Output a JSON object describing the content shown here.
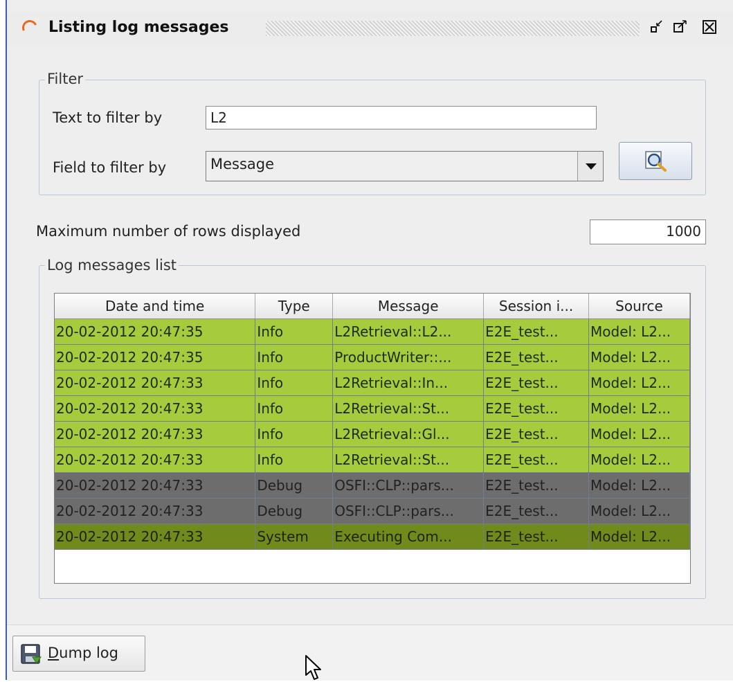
{
  "window": {
    "title": "Listing log messages",
    "controls": [
      "minimize-icon",
      "maximize-icon",
      "close-icon"
    ]
  },
  "filter": {
    "legend": "Filter",
    "text_label": "Text to filter by",
    "text_value": "L2",
    "field_label": "Field to filter by",
    "field_value": "Message",
    "search_icon": "search-icon"
  },
  "max_rows": {
    "label": "Maximum number of rows displayed",
    "value": "1000"
  },
  "log_list": {
    "legend": "Log messages list",
    "columns": [
      "Date and time",
      "Type",
      "Message",
      "Session i...",
      "Source"
    ],
    "rows": [
      {
        "datetime": "20-02-2012 20:47:35",
        "type": "Info",
        "message": "L2Retrieval::L2...",
        "session": "E2E_test...",
        "source": "Model: L2..."
      },
      {
        "datetime": "20-02-2012 20:47:35",
        "type": "Info",
        "message": "ProductWriter::...",
        "session": "E2E_test...",
        "source": "Model: L2..."
      },
      {
        "datetime": "20-02-2012 20:47:33",
        "type": "Info",
        "message": "L2Retrieval::In...",
        "session": "E2E_test...",
        "source": "Model: L2..."
      },
      {
        "datetime": "20-02-2012 20:47:33",
        "type": "Info",
        "message": "L2Retrieval::St...",
        "session": "E2E_test...",
        "source": "Model: L2..."
      },
      {
        "datetime": "20-02-2012 20:47:33",
        "type": "Info",
        "message": "L2Retrieval::Gl...",
        "session": "E2E_test...",
        "source": "Model: L2..."
      },
      {
        "datetime": "20-02-2012 20:47:33",
        "type": "Info",
        "message": "L2Retrieval::St...",
        "session": "E2E_test...",
        "source": "Model: L2..."
      },
      {
        "datetime": "20-02-2012 20:47:33",
        "type": "Debug",
        "message": "OSFI::CLP::pars...",
        "session": "E2E_test...",
        "source": "Model: L2..."
      },
      {
        "datetime": "20-02-2012 20:47:33",
        "type": "Debug",
        "message": "OSFI::CLP::pars...",
        "session": "E2E_test...",
        "source": "Model: L2..."
      },
      {
        "datetime": "20-02-2012 20:47:33",
        "type": "System",
        "message": "Executing Com...",
        "session": "E2E_test...",
        "source": "Model: L2..."
      }
    ]
  },
  "colors": {
    "info_row": "#a6cc3d",
    "debug_row": "#6d6d6d",
    "system_row": "#708a1c"
  },
  "footer": {
    "dump_label": "Dump log",
    "dump_icon": "save-icon"
  }
}
